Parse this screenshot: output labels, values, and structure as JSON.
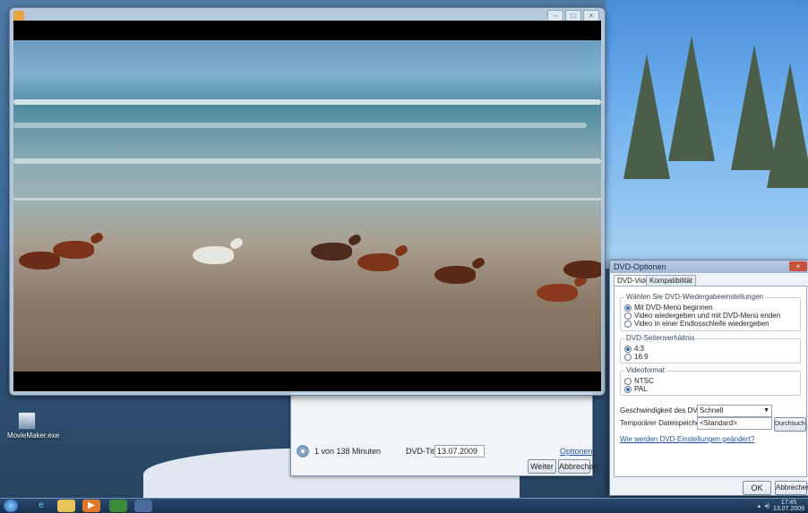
{
  "desktop": {
    "icon_label": "MovieMaker.exe"
  },
  "player_window": {
    "controls": [
      "–",
      "□",
      "×"
    ]
  },
  "burn_window": {
    "time_text": "1 von 138 Minuten",
    "title_label": "DVD-Titel:",
    "title_value": "13.07.2009",
    "options_link": "Optionen",
    "next_button": "Weiter",
    "cancel_button": "Abbrechen"
  },
  "options_dialog": {
    "title": "DVD-Optionen",
    "close": "×",
    "tabs": [
      "DVD-Video",
      "Kompatibilität"
    ],
    "playback_group": {
      "label": "Wählen Sie DVD-Wiedergabeeinstellungen",
      "options": [
        {
          "label": "Mit DVD-Menü beginnen",
          "selected": true
        },
        {
          "label": "Video wiedergeben und mit DVD-Menü enden",
          "selected": false
        },
        {
          "label": "Video in einer Endlosschleife wiedergeben",
          "selected": false
        }
      ]
    },
    "aspect_group": {
      "label": "DVD-Seitenverhältnis",
      "options": [
        {
          "label": "4:3",
          "selected": true
        },
        {
          "label": "16:9",
          "selected": false
        }
      ]
    },
    "format_group": {
      "label": "Videoformat",
      "options": [
        {
          "label": "NTSC",
          "selected": false
        },
        {
          "label": "PAL",
          "selected": true
        }
      ]
    },
    "speed_label": "Geschwindigkeit des DVD-Brenners:",
    "speed_value": "Schnell",
    "temp_label": "Temporärer Dateispeicherort:",
    "temp_value": "<Standard>",
    "browse_button": "Durchsuchen",
    "help_link": "Wie werden DVD-Einstellungen geändert?",
    "ok_button": "OK",
    "cancel_button": "Abbrechen"
  },
  "taskbar": {
    "start_icon": "windows-orb-icon",
    "pinned_icons": [
      "internet-explorer-icon",
      "explorer-folder-icon",
      "media-player-icon",
      "media-center-icon",
      "dvd-maker-icon"
    ],
    "clock_time": "17:45",
    "clock_date": "13.07.2009"
  }
}
